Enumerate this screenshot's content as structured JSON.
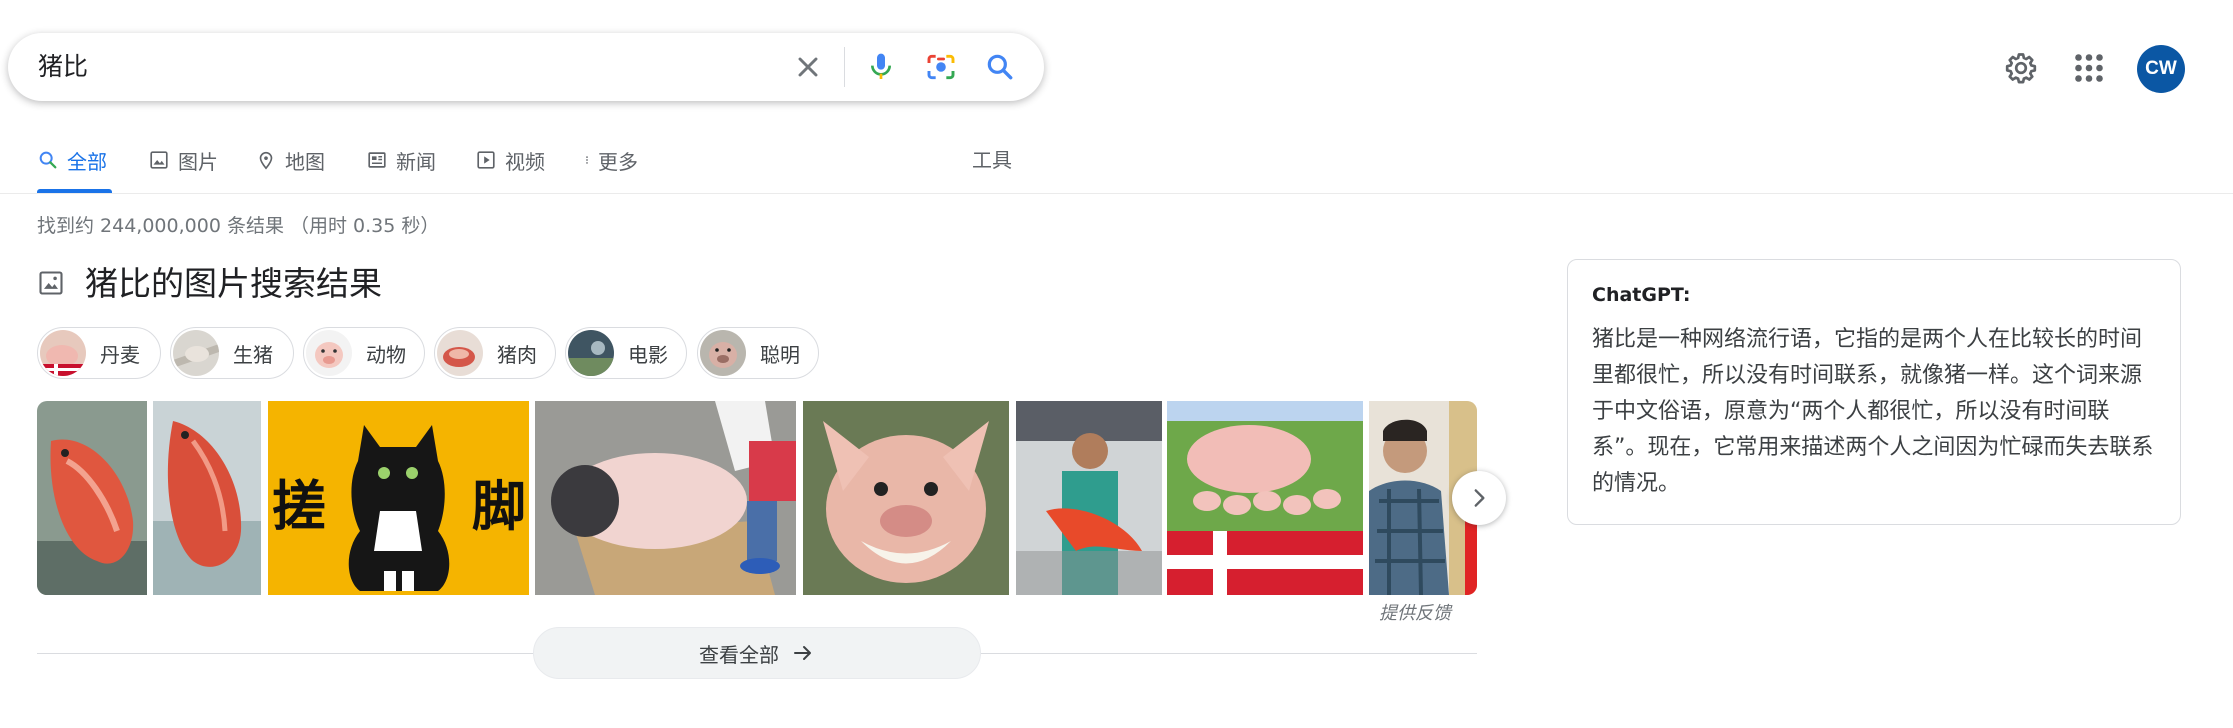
{
  "search": {
    "query": "猪比",
    "icons": [
      "close-icon",
      "microphone-icon",
      "camera-lens-icon",
      "search-icon"
    ]
  },
  "header": {
    "icons": [
      "gear-icon",
      "apps-grid-icon"
    ],
    "avatar_initials": "CW",
    "avatar_color": "#0b57a4"
  },
  "tabs": [
    {
      "label": "全部",
      "icon": "search-icon",
      "active": true
    },
    {
      "label": "图片",
      "icon": "image-icon"
    },
    {
      "label": "地图",
      "icon": "map-pin-icon"
    },
    {
      "label": "新闻",
      "icon": "news-icon"
    },
    {
      "label": "视频",
      "icon": "play-icon"
    },
    {
      "label": "更多",
      "icon": "more-vert-icon"
    }
  ],
  "tools_label": "工具",
  "result_stats": "找到约 244,000,000 条结果 （用时 0.35 秒）",
  "image_pack": {
    "title": "猪比的图片搜索结果",
    "chips": [
      "丹麦",
      "生猪",
      "动物",
      "猪肉",
      "电影",
      "聪明"
    ],
    "thumbnail_texts": [
      "搓",
      "脚"
    ],
    "feedback": "提供反馈",
    "see_all": "查看全部"
  },
  "side_panel": {
    "title": "ChatGPT:",
    "text": "猪比是一种网络流行语，它指的是两个人在比较长的时间里都很忙，所以没有时间联系，就像猪一样。这个词来源于中文俗语，原意为“两个人都很忙，所以没有时间联系”。现在，它常用来描述两个人之间因为忙碌而失去联系的情况。"
  },
  "colors": {
    "accent": "#1a73e8",
    "google_blue": "#4285f4",
    "google_red": "#ea4335",
    "google_yellow": "#fbbc04",
    "google_green": "#34a853"
  }
}
